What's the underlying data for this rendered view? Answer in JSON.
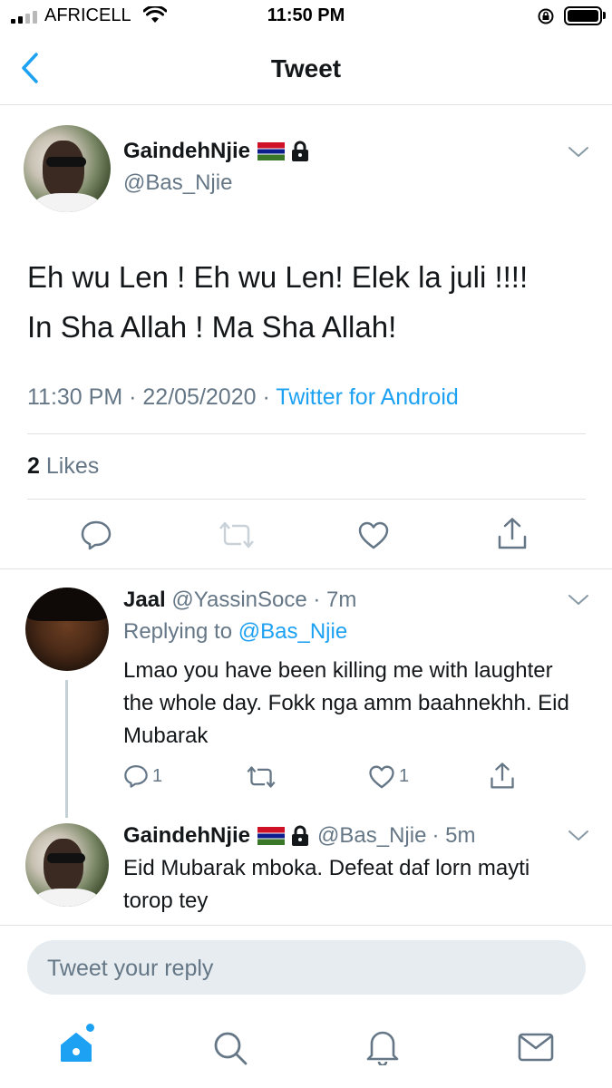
{
  "status_bar": {
    "carrier": "AFRICELL",
    "time": "11:50 PM"
  },
  "nav": {
    "title": "Tweet"
  },
  "tweet": {
    "author_name": "GaindehNjie",
    "author_handle": "@Bas_Njie",
    "text_line1": "Eh wu Len ! Eh wu Len! Elek la juli !!!!",
    "text_line2": "In Sha Allah ! Ma Sha Allah!",
    "time": "11:30 PM",
    "separator": "·",
    "date": "22/05/2020",
    "source": "Twitter for Android",
    "likes_count": "2",
    "likes_label": "Likes"
  },
  "replies": [
    {
      "name": "Jaal",
      "handle": "@YassinSoce",
      "age": "· 7m",
      "replying_prefix": "Replying to",
      "replying_to": "@Bas_Njie",
      "text": "Lmao you have been killing me with laughter the whole day. Fokk nga amm baahnekhh. Eid Mubarak",
      "reply_count": "1",
      "like_count": "1"
    },
    {
      "name": "GaindehNjie",
      "handle": "@Bas_Njie",
      "age": "· 5m",
      "text": "Eid Mubarak mboka. Defeat daf lorn mayti torop tey"
    }
  ],
  "compose": {
    "placeholder": "Tweet your reply"
  },
  "colors": {
    "accent": "#1da1f2",
    "secondary_text": "#657786",
    "divider": "#dfe3e6"
  },
  "icons": [
    "back-chevron-icon",
    "lock-icon",
    "gambia-flag-icon",
    "chevron-down-icon",
    "reply-icon",
    "retweet-icon",
    "like-icon",
    "share-icon",
    "home-icon",
    "search-icon",
    "notifications-icon",
    "messages-icon"
  ]
}
